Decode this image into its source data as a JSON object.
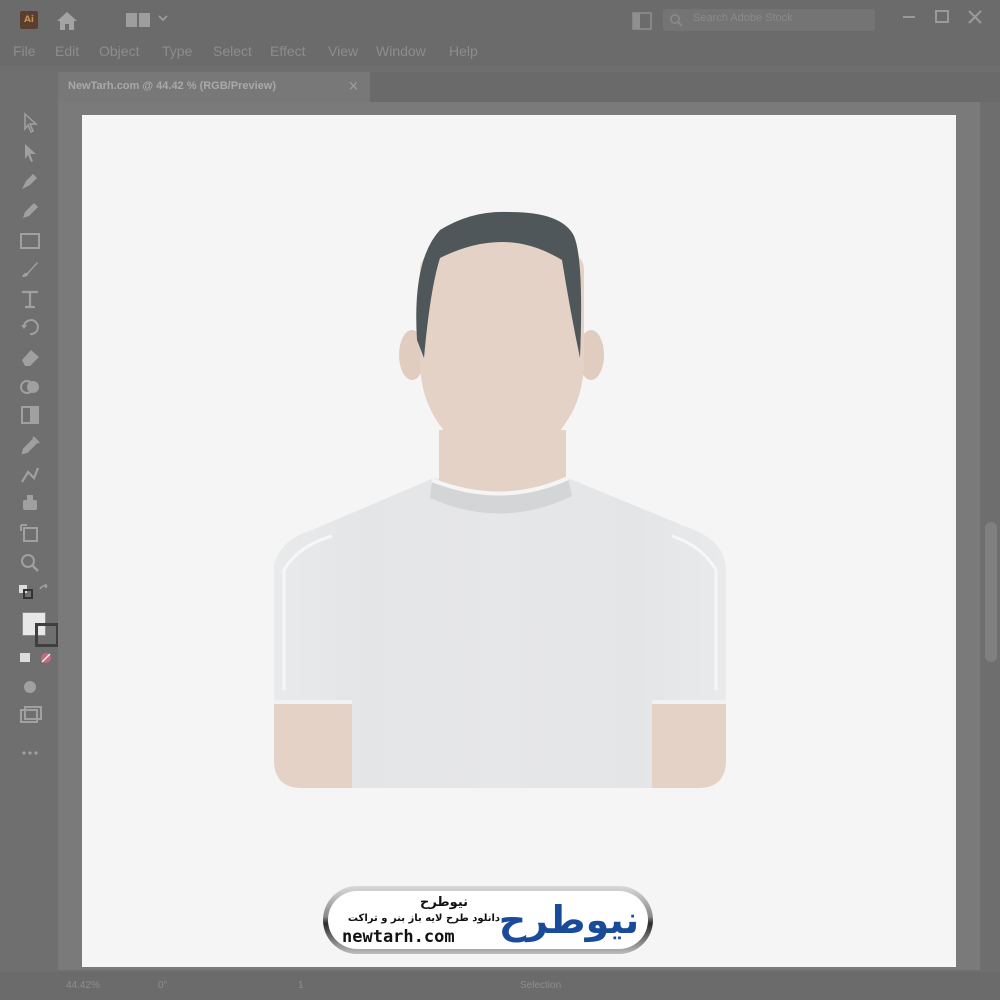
{
  "app": {
    "logo_text": "Ai"
  },
  "search": {
    "placeholder": "Search Adobe Stock"
  },
  "menu": [
    "File",
    "Edit",
    "Object",
    "Type",
    "Select",
    "Effect",
    "View",
    "Window",
    "Help"
  ],
  "document_tab": {
    "label": "NewTarh.com @ 44.42 % (RGB/Preview)",
    "close": "×"
  },
  "statusbar": {
    "zoom": "44.42%",
    "rotation": "0°",
    "artboard": "1",
    "tool": "Selection"
  },
  "watermark": {
    "title": "نیوطرح",
    "subtitle": "دانلود طرح لایه باز بنر و تراکت",
    "url": "newtarh.com",
    "logo": "نیوطرح"
  },
  "colors": {
    "hair": "#50575a",
    "skin": "#e5d2c6",
    "shirt": "#e6e7e8",
    "collar_shadow": "#d3d5d7",
    "artboard": "#f5f5f5",
    "logo_blue": "#1a4a9a",
    "logo_red": "#d8232a"
  }
}
